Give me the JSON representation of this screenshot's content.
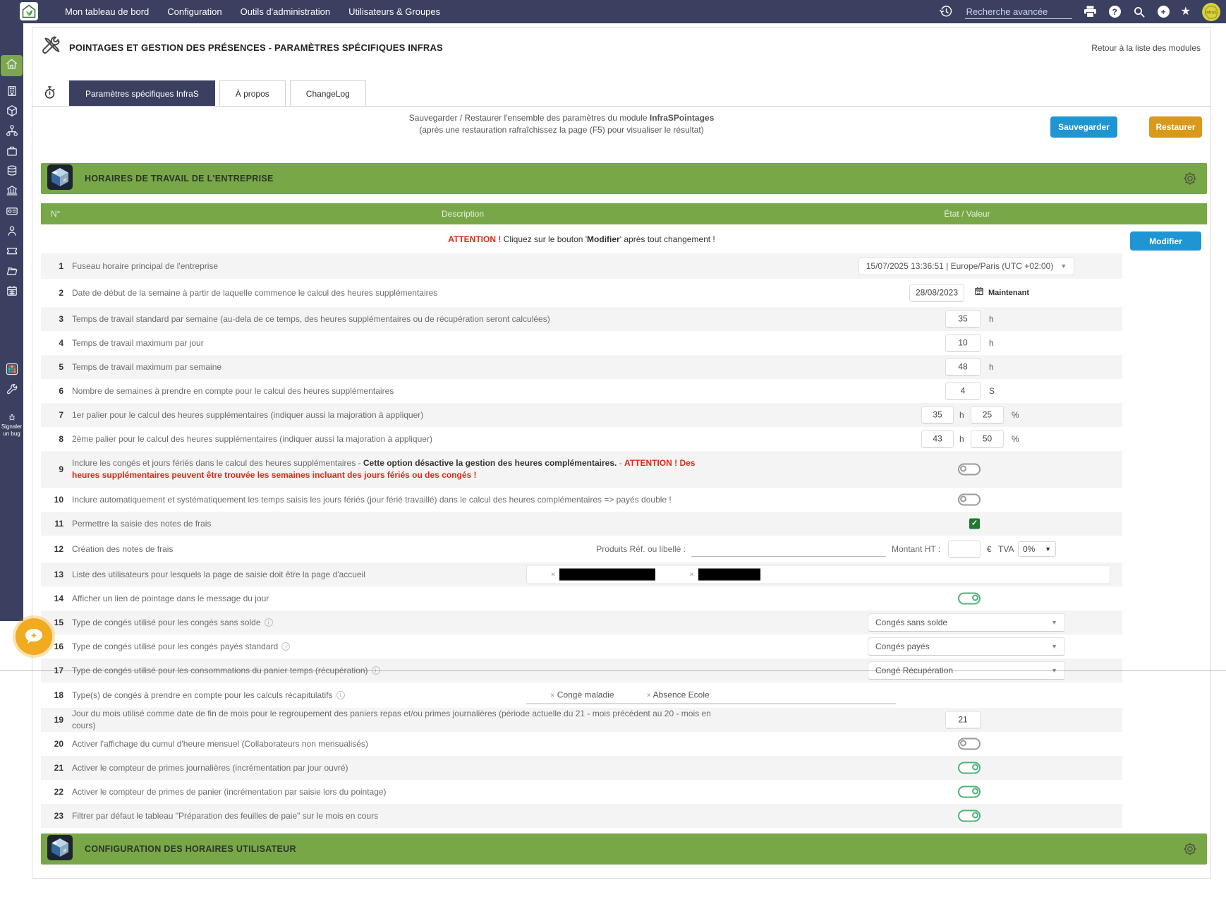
{
  "navbar": {
    "menu": [
      "Mon tableau de bord",
      "Configuration",
      "Outils d'administration",
      "Utilisateurs & Groupes"
    ],
    "search_placeholder": "Recherche avancée",
    "icons": [
      "history",
      "print",
      "help",
      "search",
      "plus",
      "star"
    ],
    "avatar_text": "infraS"
  },
  "sidebar": {
    "items": [
      "home",
      "building",
      "cube",
      "sitemap",
      "briefcase",
      "coins",
      "bank",
      "money-check",
      "user",
      "ticket",
      "folder",
      "calendar",
      "apps-colored",
      "wrench"
    ],
    "active_index": 0,
    "report_bug_line1": "Signaler",
    "report_bug_line2": "un bug"
  },
  "header": {
    "title": "POINTAGES ET GESTION DES PRÉSENCES - PARAMÈTRES SPÉCIFIQUES INFRAS",
    "back_link": "Retour à la liste des modules"
  },
  "tabs": [
    {
      "label": "Paramètres spécifiques InfraS",
      "active": true
    },
    {
      "label": "À propos",
      "active": false
    },
    {
      "label": "ChangeLog",
      "active": false
    }
  ],
  "save_bar": {
    "line1_prefix": "Sauvegarder / Restaurer l'ensemble des paramètres du module ",
    "module_name": "InfraSPointages",
    "line2": "(après une restauration rafraîchissez la page (F5) pour visualiser le résultat)",
    "save_label": "Sauvegarder",
    "restore_label": "Restaurer"
  },
  "section1": {
    "title": "HORAIRES DE TRAVAIL DE L'ENTREPRISE",
    "columns": {
      "num": "N°",
      "desc": "Description",
      "value": "État / Valeur"
    },
    "attention": {
      "red": "ATTENTION !",
      "text1": " Cliquez sur le bouton '",
      "bold": "Modifier",
      "text2": "' après tout changement !"
    },
    "modify_label": "Modifier",
    "rows": [
      {
        "num": "1",
        "desc": "Fuseau horaire principal de l'entreprise",
        "type": "timezone",
        "value": "15/07/2025 13:36:51  |  Europe/Paris (UTC +02:00)"
      },
      {
        "num": "2",
        "desc": "Date de début de la semaine à partir de laquelle commence le calcul des heures supplémentaires",
        "type": "date",
        "value": "28/08/2023",
        "action_label": "Maintenant"
      },
      {
        "num": "3",
        "desc": "Temps de travail standard par semaine (au-dela de ce temps, des heures supplémentaires ou de récupération seront calculées)",
        "type": "number",
        "value": "35",
        "unit": "h"
      },
      {
        "num": "4",
        "desc": "Temps de travail maximum par jour",
        "type": "number",
        "value": "10",
        "unit": "h"
      },
      {
        "num": "5",
        "desc": "Temps de travail maximum par semaine",
        "type": "number",
        "value": "48",
        "unit": "h"
      },
      {
        "num": "6",
        "desc": "Nombre de semaines à prendre en compte pour le calcul des heures supplémentaires",
        "type": "number",
        "value": "4",
        "unit": "S"
      },
      {
        "num": "7",
        "desc": "1er palier pour le calcul des heures supplémentaires (indiquer aussi la majoration à appliquer)",
        "type": "number2",
        "value1": "35",
        "unit1": "h",
        "value2": "25",
        "unit2": "%"
      },
      {
        "num": "8",
        "desc": "2ème palier pour le calcul des heures supplémentaires (indiquer aussi la majoration à appliquer)",
        "type": "number2",
        "value1": "43",
        "unit1": "h",
        "value2": "50",
        "unit2": "%"
      },
      {
        "num": "9",
        "desc_parts": [
          {
            "text": "Inclure les congés et jours fériés dans le calcul des heures supplémentaires - ",
            "style": "normal"
          },
          {
            "text": "Cette option désactive la gestion des heures complémentaires.",
            "style": "bold"
          },
          {
            "text": " - ",
            "style": "normal"
          },
          {
            "text": "ATTENTION ! Des heures supplémentaires peuvent être trouvée les semaines incluant des jours fériés ou des congés !",
            "style": "red"
          }
        ],
        "type": "toggle",
        "state": "off"
      },
      {
        "num": "10",
        "desc": "Inclure automatiquement et systématiquement les temps saisis les jours fériés (jour férié travaillé) dans le calcul des heures complémentaires => payés double !",
        "type": "toggle",
        "state": "off"
      },
      {
        "num": "11",
        "desc": "Permettre la saisie des notes de frais",
        "type": "checkbox",
        "state": "checked"
      },
      {
        "num": "12",
        "desc": "Création des notes de frais",
        "type": "expense",
        "products_label": "Produits  Réf. ou libellé :",
        "amount_label": "Montant HT :",
        "currency": "€",
        "vat_label": "TVA",
        "vat_value": "0%"
      },
      {
        "num": "13",
        "desc": "Liste des utilisateurs pour lesquels la page de saisie doit être la page d'accueil",
        "type": "userlist",
        "chips": [
          {
            "redacted": true,
            "width": 136
          },
          {
            "redacted": true,
            "width": 88
          }
        ]
      },
      {
        "num": "14",
        "desc": "Afficher un lien de pointage dans le message du jour",
        "type": "toggle",
        "state": "on"
      },
      {
        "num": "15",
        "desc": "Type de congés utilisé pour les congés sans solde",
        "info": true,
        "type": "select",
        "value": "Congés sans solde"
      },
      {
        "num": "16",
        "desc": "Type de congés utilisé pour les congés payés standard",
        "info": true,
        "type": "select",
        "value": "Congés payés"
      },
      {
        "num": "17",
        "desc": "Type de congés utilisé pour les consommations du panier temps (récupération)",
        "info": true,
        "type": "select",
        "value": "Congé Récupération"
      },
      {
        "num": "18",
        "desc": "Type(s) de congés à prendre en compte pour les calculs récapitulatifs",
        "info": true,
        "type": "tags",
        "tags": [
          "Congé maladie",
          "Absence Ecole"
        ]
      },
      {
        "num": "19",
        "desc": "Jour du mois utilisé comme date de fin de mois pour le regroupement des paniers repas et/ou primes journalières (période actuelle du 21 - mois précédent au 20 - mois en cours)",
        "type": "number",
        "value": "21",
        "unit": ""
      },
      {
        "num": "20",
        "desc": "Activer l'affichage du cumul d'heure mensuel (Collaborateurs non mensualisés)",
        "type": "toggle",
        "state": "off"
      },
      {
        "num": "21",
        "desc": "Activer le compteur de primes journalières (incrémentation par jour ouvré)",
        "type": "toggle",
        "state": "on"
      },
      {
        "num": "22",
        "desc": "Activer le compteur de primes de panier (incrémentation par saisie lors du pointage)",
        "type": "toggle",
        "state": "on"
      },
      {
        "num": "23",
        "desc": "Filtrer par défaut le tableau \"Préparation des feuilles de paie\" sur le mois en cours",
        "type": "toggle",
        "state": "on"
      }
    ]
  },
  "section2": {
    "title": "CONFIGURATION DES HORAIRES UTILISATEUR"
  },
  "colors": {
    "navy": "#3b4060",
    "green": "#78a748",
    "blue_button": "#1f95d4",
    "orange_button": "#d9991c",
    "alert_red": "#e22718",
    "toggle_on": "#4db377",
    "checkbox_green": "#1f7a2d"
  }
}
